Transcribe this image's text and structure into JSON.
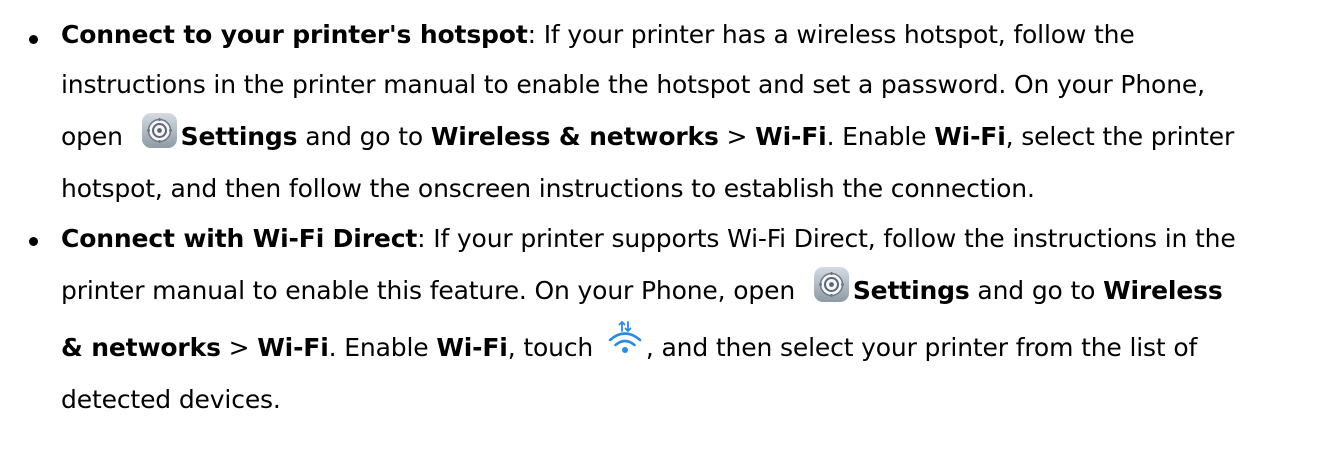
{
  "items": [
    {
      "title": "Connect to your printer's hotspot",
      "line1_rest": ": If your printer has a wireless hotspot, follow the",
      "line2": "instructions in the printer manual to enable the hotspot and set a password. On your Phone,",
      "line3_open": "open ",
      "settings_label": "Settings",
      "line3_goto": " and go to ",
      "wireless_networks": "Wireless & networks",
      "gt": " > ",
      "wifi": "Wi-Fi",
      "line3_enable": ". Enable ",
      "wifi_enable": "Wi-Fi",
      "line3_tail": ", select the printer",
      "line4": "hotspot, and then follow the onscreen instructions to establish the connection."
    },
    {
      "title": "Connect with Wi-Fi Direct",
      "line1_rest": ": If your printer supports Wi-Fi Direct, follow the instructions in the",
      "line2_head": "printer manual to enable this feature. On your Phone, open ",
      "settings_label": "Settings",
      "line2_goto": " and go to ",
      "wireless": "Wireless",
      "networks": "& networks",
      "gt": " > ",
      "wifi": "Wi-Fi",
      "line3_enable": ". Enable ",
      "wifi_enable": "Wi-Fi",
      "line3_touch": ", touch ",
      "line3_tail": ", and then select your printer from the list of",
      "line4": "detected devices."
    }
  ],
  "icons": {
    "settings": "settings-gear-icon",
    "wifi_direct": "wifi-direct-icon",
    "bullet": "bullet-dot"
  },
  "colors": {
    "text": "#000000",
    "wifi_icon": "#2a8be0",
    "settings_icon_bg": "#b9c2cb"
  }
}
